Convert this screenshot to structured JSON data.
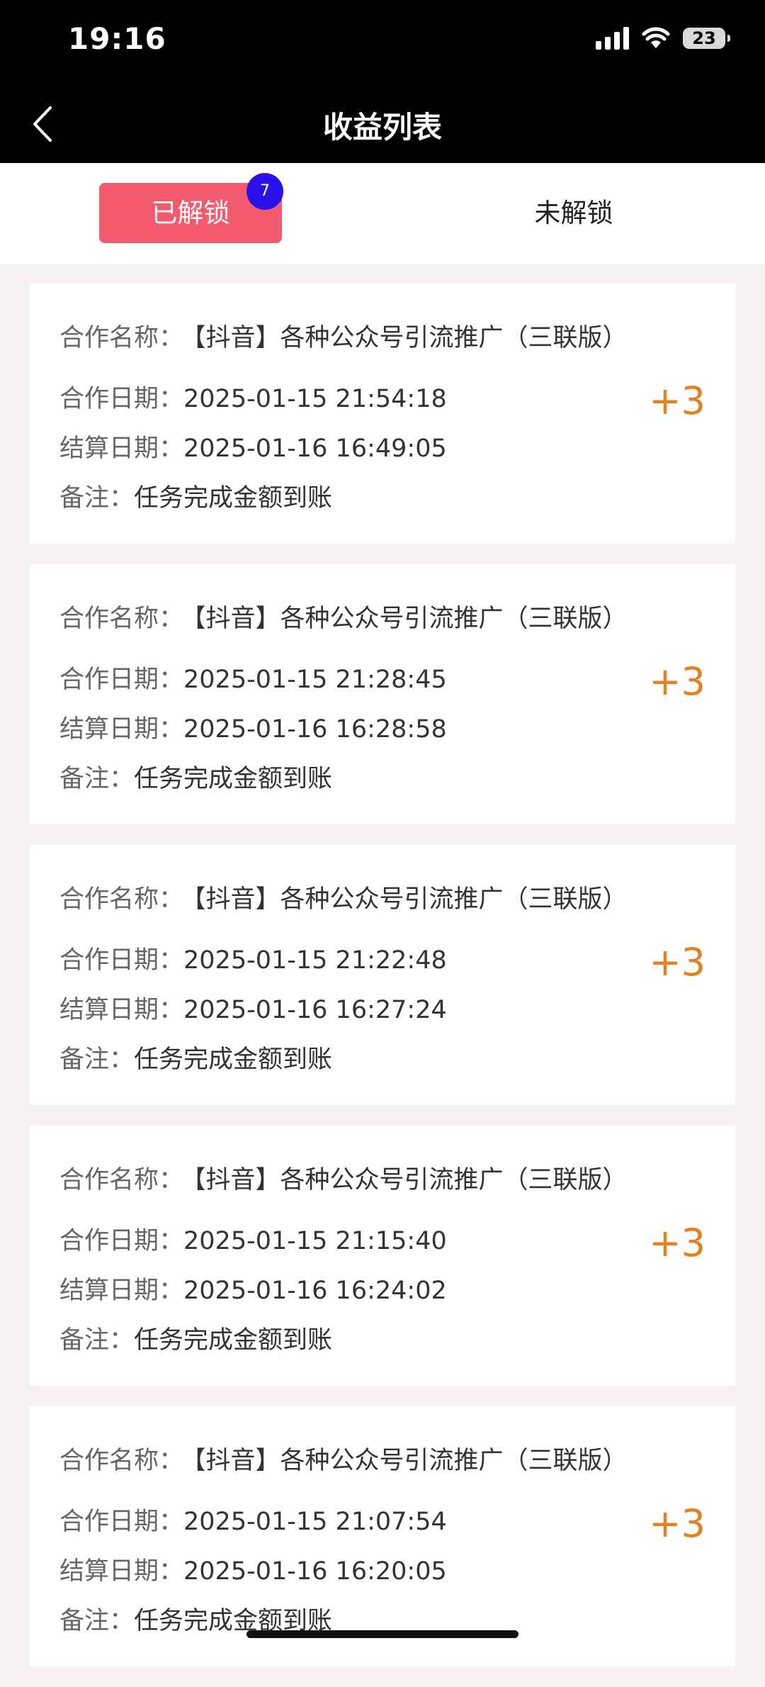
{
  "status_bar": {
    "time": "19:16",
    "battery": "23",
    "icons": [
      "signal-icon",
      "wifi-icon",
      "battery-icon"
    ]
  },
  "nav": {
    "title": "收益列表",
    "back_icon": "chevron-left-icon"
  },
  "tabs": {
    "unlocked_label": "已解锁",
    "unlocked_badge": "7",
    "locked_label": "未解锁"
  },
  "labels": {
    "name": "合作名称：",
    "coop_date": "合作日期：",
    "settle_date": "结算日期：",
    "note": "备注："
  },
  "records": [
    {
      "name": "【抖音】各种公众号引流推广（三联版）",
      "coop_date": "2025-01-15 21:54:18",
      "settle_date": "2025-01-16 16:49:05",
      "note": "任务完成金额到账",
      "amount": "+3"
    },
    {
      "name": "【抖音】各种公众号引流推广（三联版）",
      "coop_date": "2025-01-15 21:28:45",
      "settle_date": "2025-01-16 16:28:58",
      "note": "任务完成金额到账",
      "amount": "+3"
    },
    {
      "name": "【抖音】各种公众号引流推广（三联版）",
      "coop_date": "2025-01-15 21:22:48",
      "settle_date": "2025-01-16 16:27:24",
      "note": "任务完成金额到账",
      "amount": "+3"
    },
    {
      "name": "【抖音】各种公众号引流推广（三联版）",
      "coop_date": "2025-01-15 21:15:40",
      "settle_date": "2025-01-16 16:24:02",
      "note": "任务完成金额到账",
      "amount": "+3"
    },
    {
      "name": "【抖音】各种公众号引流推广（三联版）",
      "coop_date": "2025-01-15 21:07:54",
      "settle_date": "2025-01-16 16:20:05",
      "note": "任务完成金额到账",
      "amount": "+3"
    }
  ],
  "colors": {
    "active_tab": "#f45a6e",
    "badge": "#2a10e8",
    "amount": "#e67e22",
    "header": "#000000"
  }
}
